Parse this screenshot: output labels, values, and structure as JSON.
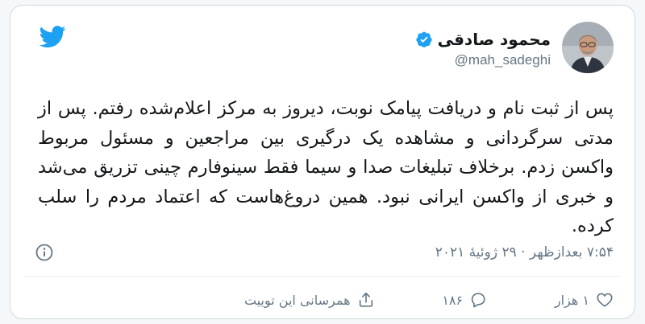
{
  "author": {
    "name": "محمود صادقی",
    "handle": "@mah_sadeghi"
  },
  "tweet": {
    "text": "پس از ثبت نام و دریافت پیامک نوبت، دیروز به مرکز اعلام‌شده رفتم. پس از مدتی سرگردانی و مشاهده یک درگیری بین مراجعین و مسئول مربوط واکسن زدم. برخلاف تبلیغات صدا و سیما فقط سینوفارم چینی تزریق می‌شد و خبری از واکسن ایرانی نبود. همین دروغ‌هاست که اعتماد مردم را سلب کرده.",
    "timestamp": "۷:۵۴ بعدازظهر · ۲۹ ژوئیهٔ ۲۰۲۱"
  },
  "actions": {
    "likes": "۱ هزار",
    "replies": "۱۸۶",
    "share_label": "همرسانی این توییت"
  },
  "colors": {
    "brand": "#1da1f2",
    "text": "#14171a",
    "muted": "#657786",
    "border": "#cfd9de"
  },
  "icons": [
    "twitter-bird-icon",
    "verified-badge-icon",
    "info-icon",
    "heart-icon",
    "reply-icon",
    "share-icon"
  ]
}
